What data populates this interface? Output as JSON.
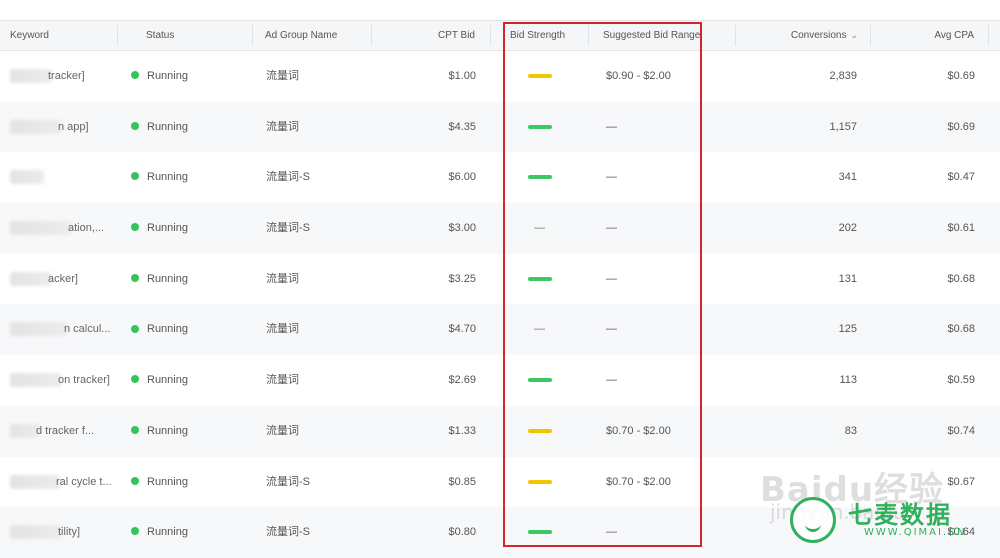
{
  "columns": {
    "keyword": "Keyword",
    "status": "Status",
    "ad_group": "Ad Group Name",
    "cpt_bid": "CPT Bid",
    "bid_strength": "Bid Strength",
    "suggested": "Suggested Bid Range",
    "conversions": "Conversions",
    "avg_cpa": "Avg CPA"
  },
  "colors": {
    "strength_green": "#3cc864",
    "strength_yellow": "#f2c500",
    "running": "#35c35e",
    "highlight": "#d8232a"
  },
  "rows": [
    {
      "keyword": "tracker]",
      "status": "Running",
      "ad_group": "流量词",
      "cpt_bid": "$1.00",
      "bid_strength": "yellow",
      "suggested": "$0.90 - $2.00",
      "conversions": "2,839",
      "avg_cpa": "$0.69"
    },
    {
      "keyword": "n app]",
      "status": "Running",
      "ad_group": "流量词",
      "cpt_bid": "$4.35",
      "bid_strength": "green",
      "suggested": "—",
      "conversions": "1,157",
      "avg_cpa": "$0.69"
    },
    {
      "keyword": "",
      "status": "Running",
      "ad_group": "流量词-S",
      "cpt_bid": "$6.00",
      "bid_strength": "green",
      "suggested": "—",
      "conversions": "341",
      "avg_cpa": "$0.47"
    },
    {
      "keyword": "ation,...",
      "status": "Running",
      "ad_group": "流量词-S",
      "cpt_bid": "$3.00",
      "bid_strength": "none",
      "suggested": "—",
      "conversions": "202",
      "avg_cpa": "$0.61"
    },
    {
      "keyword": "acker]",
      "status": "Running",
      "ad_group": "流量词",
      "cpt_bid": "$3.25",
      "bid_strength": "green",
      "suggested": "—",
      "conversions": "131",
      "avg_cpa": "$0.68"
    },
    {
      "keyword": "n calcul...",
      "status": "Running",
      "ad_group": "流量词",
      "cpt_bid": "$4.70",
      "bid_strength": "none",
      "suggested": "—",
      "conversions": "125",
      "avg_cpa": "$0.68"
    },
    {
      "keyword": "on tracker]",
      "status": "Running",
      "ad_group": "流量词",
      "cpt_bid": "$2.69",
      "bid_strength": "green",
      "suggested": "—",
      "conversions": "113",
      "avg_cpa": "$0.59"
    },
    {
      "keyword": "d tracker f...",
      "status": "Running",
      "ad_group": "流量词",
      "cpt_bid": "$1.33",
      "bid_strength": "yellow",
      "suggested": "$0.70 - $2.00",
      "conversions": "83",
      "avg_cpa": "$0.74"
    },
    {
      "keyword": "ral cycle t...",
      "status": "Running",
      "ad_group": "流量词-S",
      "cpt_bid": "$0.85",
      "bid_strength": "yellow",
      "suggested": "$0.70 - $2.00",
      "conversions": "",
      "avg_cpa": "$0.67"
    },
    {
      "keyword": "tility]",
      "status": "Running",
      "ad_group": "流量词-S",
      "cpt_bid": "$0.80",
      "bid_strength": "green",
      "suggested": "—",
      "conversions": "",
      "avg_cpa": "$0.64"
    }
  ],
  "none_marker": "—",
  "watermark": {
    "baidu": "Baidu经验",
    "baidu_sub": "jingyan.baidu",
    "brand": "七麦数据",
    "brand_sub": "WWW.QIMAI.CN"
  }
}
